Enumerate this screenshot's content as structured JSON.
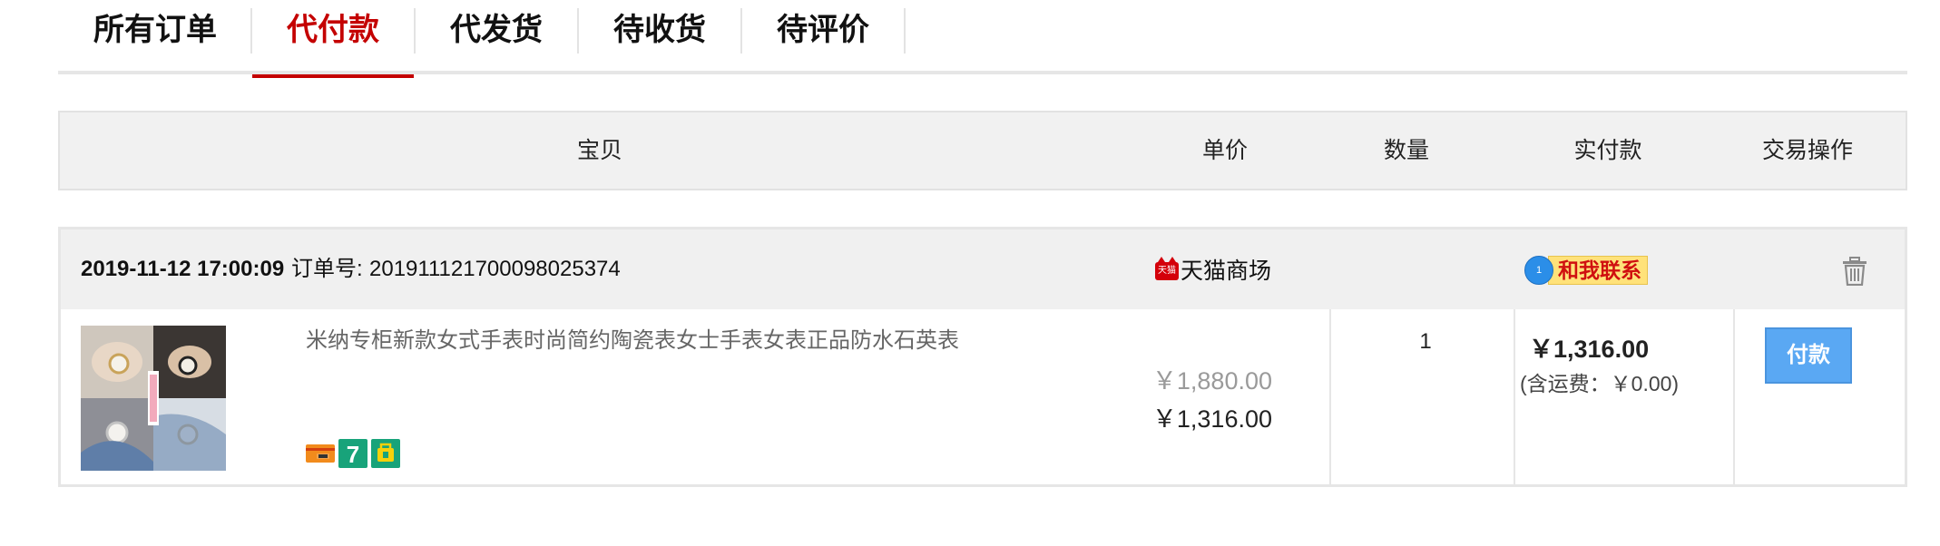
{
  "tabs": [
    {
      "label": "所有订单",
      "active": false
    },
    {
      "label": "代付款",
      "active": true
    },
    {
      "label": "代发货",
      "active": false
    },
    {
      "label": "待收货",
      "active": false
    },
    {
      "label": "待评价",
      "active": false
    }
  ],
  "columns": {
    "item": "宝贝",
    "unit_price": "单价",
    "quantity": "数量",
    "paid": "实付款",
    "actions": "交易操作"
  },
  "order": {
    "date": "2019-11-12 17:00:09",
    "order_no_label": "订单号:",
    "order_no": "20191112170009802 5374",
    "shop_icon_text": "天猫",
    "shop_name": "天猫商场",
    "contact_count": "1",
    "contact_label": "和我联系",
    "item_title": "米纳专柜新款女式手表时尚简约陶瓷表女士手表女表正品防水石英表",
    "original_price": "￥1,880.00",
    "price": "￥1,316.00",
    "quantity": "1",
    "paid": "￥1,316.00",
    "shipping": "(含运费：￥0.00)",
    "pay_button": "付款",
    "badges": [
      "credit-card-badge",
      "seven-day-return-badge",
      "guarantee-badge"
    ],
    "icons": {
      "trash": "trash-icon",
      "contact": "chat-bubble-icon"
    }
  },
  "colors": {
    "accent": "#c40000",
    "header_bg": "#f1f1f1",
    "pay_button": "#5aa8f3",
    "contact_bg": "#ffe27a"
  }
}
